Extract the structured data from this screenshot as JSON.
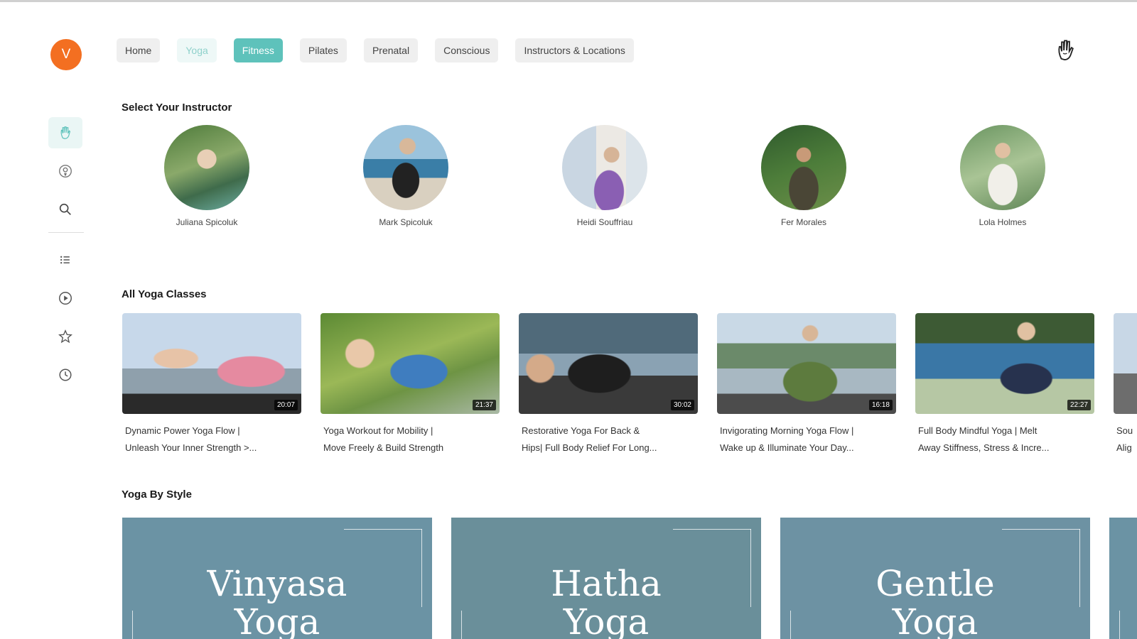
{
  "user": {
    "initial": "V"
  },
  "nav": {
    "tabs": [
      "Home",
      "Yoga",
      "Fitness",
      "Pilates",
      "Prenatal",
      "Conscious",
      "Instructors & Locations"
    ],
    "active": "Fitness"
  },
  "sidebar": {
    "icons": [
      "hand-logo-icon",
      "podcast-icon",
      "search-icon",
      "list-icon",
      "play-icon",
      "star-icon",
      "history-icon"
    ]
  },
  "instructors": {
    "title": "Select Your Instructor",
    "items": [
      {
        "name": "Juliana Spicoluk"
      },
      {
        "name": "Mark Spicoluk"
      },
      {
        "name": "Heidi Souffriau"
      },
      {
        "name": "Fer Morales"
      },
      {
        "name": "Lola Holmes"
      }
    ]
  },
  "classes": {
    "title": "All Yoga Classes",
    "items": [
      {
        "line1": "Dynamic Power Yoga Flow |",
        "line2": "Unleash Your Inner Strength >...",
        "duration": "20:07"
      },
      {
        "line1": "Yoga Workout for Mobility |",
        "line2": "Move Freely & Build Strength",
        "duration": "21:37"
      },
      {
        "line1": "Restorative Yoga For Back &",
        "line2": "Hips| Full Body Relief For Long...",
        "duration": "30:02"
      },
      {
        "line1": "Invigorating Morning Yoga Flow |",
        "line2": "Wake up & Illuminate Your Day...",
        "duration": "16:18"
      },
      {
        "line1": "Full Body Mindful Yoga | Melt",
        "line2": "Away Stiffness, Stress & Incre...",
        "duration": "22:27"
      },
      {
        "line1": "Sou",
        "line2": "Alig",
        "duration": ""
      }
    ]
  },
  "styles": {
    "title": "Yoga By Style",
    "items": [
      {
        "line1": "Vinyasa",
        "line2": "Yoga"
      },
      {
        "line1": "Hatha",
        "line2": "Yoga"
      },
      {
        "line1": "Gentle",
        "line2": "Yoga"
      }
    ]
  },
  "colors": {
    "accent": "#5ec2bb",
    "avatar": "#f36f21",
    "style_card": "#6b93a4"
  }
}
